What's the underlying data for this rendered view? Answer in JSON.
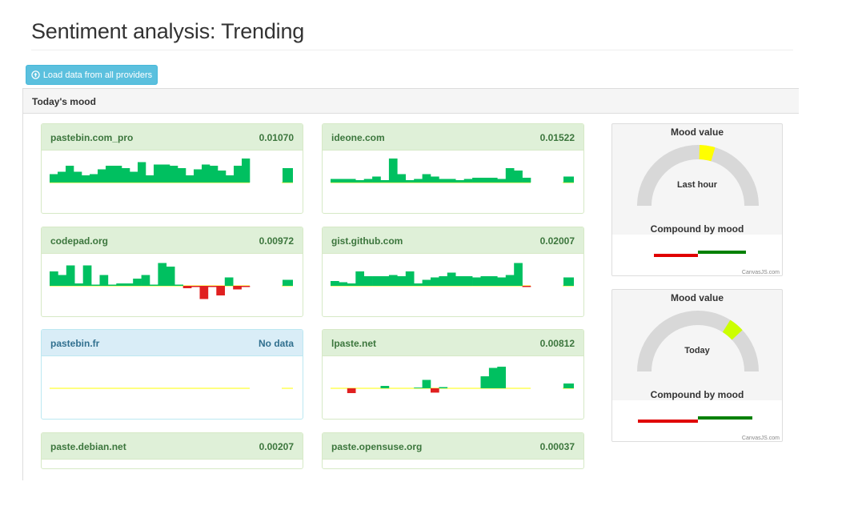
{
  "page": {
    "title": "Sentiment analysis: Trending"
  },
  "toolbar": {
    "load_label": "Load data from all providers"
  },
  "mood": {
    "heading": "Today's mood"
  },
  "providers": [
    {
      "name": "pastebin.com_pro",
      "value": "0.01070",
      "status": "success",
      "series": [
        0.35,
        0.45,
        0.7,
        0.45,
        0.3,
        0.35,
        0.55,
        0.7,
        0.7,
        0.6,
        0.45,
        0.85,
        0.3,
        0.75,
        0.75,
        0.7,
        0.6,
        0.3,
        0.55,
        0.75,
        0.7,
        0.5,
        0.3,
        0.7,
        1.0
      ],
      "current": 0.6
    },
    {
      "name": "ideone.com",
      "value": "0.01522",
      "status": "success",
      "series": [
        0.15,
        0.15,
        0.15,
        0.1,
        0.15,
        0.25,
        0.1,
        1.0,
        0.35,
        0.1,
        0.15,
        0.35,
        0.25,
        0.15,
        0.15,
        0.1,
        0.15,
        0.2,
        0.2,
        0.2,
        0.15,
        0.6,
        0.5,
        0.2
      ],
      "current": 0.25
    },
    {
      "name": "codepad.org",
      "value": "0.00972",
      "status": "success",
      "series": [
        0.6,
        0.45,
        0.85,
        0.1,
        0.85,
        0.05,
        0.45,
        0.05,
        0.1,
        0.1,
        0.3,
        0.45,
        0.05,
        0.95,
        0.8,
        0.05,
        -0.1,
        -0.05,
        -0.55,
        -0.05,
        -0.4,
        0.35,
        -0.15,
        -0.05
      ],
      "current": 0.25
    },
    {
      "name": "gist.github.com",
      "value": "0.02007",
      "status": "success",
      "series": [
        0.2,
        0.15,
        0.1,
        0.6,
        0.4,
        0.4,
        0.4,
        0.45,
        0.4,
        0.6,
        0.1,
        0.25,
        0.35,
        0.4,
        0.55,
        0.4,
        0.4,
        0.35,
        0.4,
        0.4,
        0.35,
        0.45,
        0.95,
        -0.05
      ],
      "current": 0.35
    },
    {
      "name": "pastebin.fr",
      "value": "No data",
      "status": "info",
      "series": [],
      "current": 0
    },
    {
      "name": "lpaste.net",
      "value": "0.00812",
      "status": "success",
      "series": [
        0,
        0,
        -0.2,
        0,
        0,
        0,
        0.1,
        0,
        0,
        0,
        0.03,
        0.35,
        -0.18,
        0.05,
        0,
        0,
        0,
        0,
        0.5,
        0.85,
        0.9,
        0,
        0,
        0
      ],
      "current": 0.2
    },
    {
      "name": "paste.debian.net",
      "value": "0.00207",
      "status": "success",
      "series": [],
      "current": 0
    },
    {
      "name": "paste.opensuse.org",
      "value": "0.00037",
      "status": "success",
      "series": [],
      "current": 0
    }
  ],
  "gauges": [
    {
      "title": "Mood value",
      "label": "Last hour",
      "mood_level": 0.55,
      "mood_color": "#ffff00",
      "compound_title": "Compound by mood",
      "negative": 0.55,
      "positive": 0.6,
      "credit": "CanvasJS.com"
    },
    {
      "title": "Mood value",
      "label": "Today",
      "mood_level": 0.72,
      "mood_color": "#ccff00",
      "compound_title": "Compound by mood",
      "negative": 0.75,
      "positive": 0.68,
      "credit": "CanvasJS.com"
    }
  ],
  "colors": {
    "positive": "#00c060",
    "negative": "#e02020",
    "baseline": "#ffff00",
    "gauge_track": "#d8d8d8"
  }
}
